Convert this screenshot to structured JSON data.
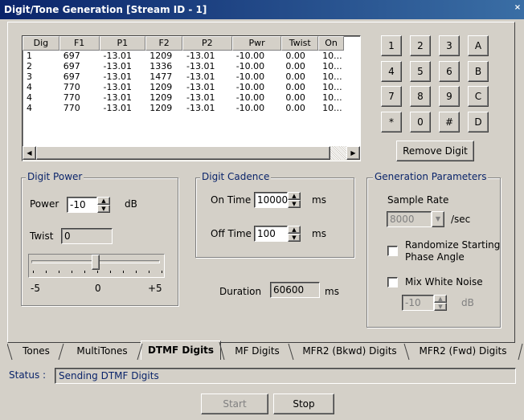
{
  "window": {
    "title": "Digit/Tone Generation [Stream ID - 1]",
    "close_glyph": "×"
  },
  "table": {
    "columns": [
      "Dig",
      "F1",
      "P1",
      "F2",
      "P2",
      "Pwr",
      "Twist",
      "On"
    ],
    "rows": [
      [
        "1",
        "697",
        "-13.01",
        "1209",
        "-13.01",
        "-10.00",
        "0.00",
        "10..."
      ],
      [
        "2",
        "697",
        "-13.01",
        "1336",
        "-13.01",
        "-10.00",
        "0.00",
        "10..."
      ],
      [
        "3",
        "697",
        "-13.01",
        "1477",
        "-13.01",
        "-10.00",
        "0.00",
        "10..."
      ],
      [
        "4",
        "770",
        "-13.01",
        "1209",
        "-13.01",
        "-10.00",
        "0.00",
        "10..."
      ],
      [
        "4",
        "770",
        "-13.01",
        "1209",
        "-13.01",
        "-10.00",
        "0.00",
        "10..."
      ],
      [
        "4",
        "770",
        "-13.01",
        "1209",
        "-13.01",
        "-10.00",
        "0.00",
        "10..."
      ]
    ]
  },
  "keypad": {
    "keys": [
      "1",
      "2",
      "3",
      "A",
      "4",
      "5",
      "6",
      "B",
      "7",
      "8",
      "9",
      "C",
      "*",
      "0",
      "#",
      "D"
    ],
    "remove_digit_label": "Remove Digit"
  },
  "digit_power": {
    "group_label": "Digit Power",
    "power_label": "Power",
    "power_value": "-10",
    "power_unit": "dB",
    "twist_label": "Twist",
    "twist_value": "0",
    "slider_min_label": "-5",
    "slider_mid_label": "0",
    "slider_max_label": "+5",
    "slider_value": 0
  },
  "digit_cadence": {
    "group_label": "Digit Cadence",
    "on_time_label": "On Time",
    "on_time_value": "10000",
    "on_time_unit": "ms",
    "off_time_label": "Off Time",
    "off_time_value": "100",
    "off_time_unit": "ms"
  },
  "duration": {
    "label": "Duration",
    "value": "60600",
    "unit": "ms"
  },
  "generation_parameters": {
    "group_label": "Generation Parameters",
    "sample_rate_label": "Sample Rate",
    "sample_rate_value": "8000",
    "sample_rate_unit": "/sec",
    "randomize_label_line1": "Randomize Starting",
    "randomize_label_line2": "Phase Angle",
    "randomize_checked": false,
    "white_noise_label": "Mix White Noise",
    "white_noise_checked": false,
    "noise_value": "-10",
    "noise_unit": "dB"
  },
  "tabs": [
    {
      "label": "Tones",
      "active": false
    },
    {
      "label": "MultiTones",
      "active": false
    },
    {
      "label": "DTMF Digits",
      "active": true
    },
    {
      "label": "MF Digits",
      "active": false
    },
    {
      "label": "MFR2 (Bkwd) Digits",
      "active": false
    },
    {
      "label": "MFR2 (Fwd) Digits",
      "active": false
    }
  ],
  "status": {
    "label": "Status :",
    "text": "Sending DTMF Digits"
  },
  "buttons": {
    "start_label": "Start",
    "start_enabled": false,
    "stop_label": "Stop"
  },
  "colors": {
    "title_bar": "#0a246a",
    "group_label": "#0a246a",
    "face": "#d4d0c8"
  }
}
